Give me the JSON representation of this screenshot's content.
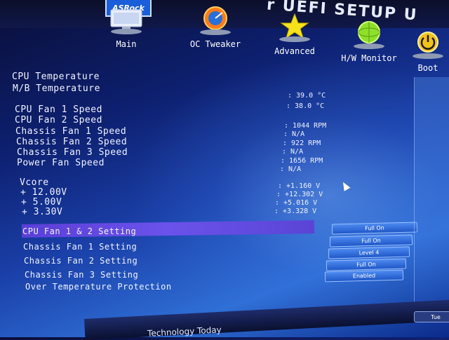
{
  "header": {
    "title": "r UEFI SETUP U",
    "logo": "ASRock"
  },
  "nav": [
    {
      "label": "Main",
      "icon": "monitor-icon"
    },
    {
      "label": "OC Tweaker",
      "icon": "speedometer-icon"
    },
    {
      "label": "Advanced",
      "icon": "star-icon"
    },
    {
      "label": "H/W Monitor",
      "icon": "globe-icon"
    },
    {
      "label": "Boot",
      "icon": "power-icon"
    }
  ],
  "monitor": {
    "cpu_temp": {
      "label": "CPU Temperature",
      "value": ": 39.0 °C"
    },
    "mb_temp": {
      "label": "M/B Temperature",
      "value": ": 38.0 °C"
    },
    "cpu_fan1": {
      "label": "CPU Fan 1 Speed",
      "value": ": 1044 RPM"
    },
    "cpu_fan2": {
      "label": "CPU Fan 2 Speed",
      "value": ": N/A"
    },
    "chassis_fan1": {
      "label": "Chassis Fan 1 Speed",
      "value": ": 922 RPM"
    },
    "chassis_fan2": {
      "label": "Chassis Fan 2 Speed",
      "value": ": N/A"
    },
    "chassis_fan3": {
      "label": "Chassis Fan 3 Speed",
      "value": ": 1656 RPM"
    },
    "power_fan": {
      "label": "Power Fan Speed",
      "value": ": N/A"
    },
    "vcore": {
      "label": "Vcore",
      "value": ": +1.160 V"
    },
    "v12": {
      "label": "+ 12.00V",
      "value": ": +12.302 V"
    },
    "v5": {
      "label": "+ 5.00V",
      "value": ": +5.016 V"
    },
    "v33": {
      "label": "+ 3.30V",
      "value": ": +3.328 V"
    }
  },
  "settings": [
    {
      "label": "CPU Fan 1 & 2 Setting",
      "value": "Full On"
    },
    {
      "label": "Chassis Fan 1 Setting",
      "value": "Full On"
    },
    {
      "label": "Chassis Fan 2 Setting",
      "value": "Level 4"
    },
    {
      "label": "Chassis Fan 3 Setting",
      "value": "Full On"
    },
    {
      "label": "Over Temperature Protection",
      "value": "Enabled"
    }
  ],
  "footer": {
    "tagline": "Technology Today",
    "datetime": "Tue"
  },
  "colors": {
    "highlight": "#5a3fd8",
    "button": "#2f6fe0",
    "accent_yellow": "#f6e21a",
    "accent_green": "#8ee02a"
  }
}
